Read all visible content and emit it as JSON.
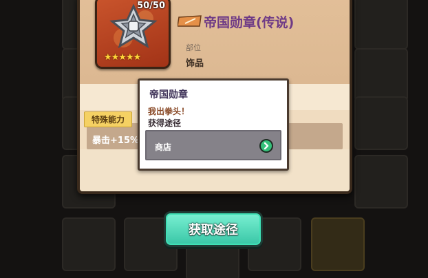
{
  "item": {
    "title": "帝国勋章(传说)",
    "count": "50/50",
    "stars": "★★★★★",
    "slot_label": "部位",
    "slot_value": "饰品"
  },
  "ability": {
    "label": "特殊能力",
    "description": "暴击+15%。"
  },
  "tooltip": {
    "title": "帝国勋章",
    "flavor": "我出拳头！",
    "source_label": "获得途径",
    "sources": [
      "商店"
    ]
  },
  "actions": {
    "obtain_label": "获取途径"
  },
  "icons": {
    "portrait": "medal-icon",
    "rarity": "rarity-tag-icon",
    "go": "arrow-right-circle-icon"
  },
  "colors": {
    "title": "#6e3a86",
    "button": "#4fdcb8",
    "go": "#35c07a",
    "ability_tag": "#f5d163"
  }
}
